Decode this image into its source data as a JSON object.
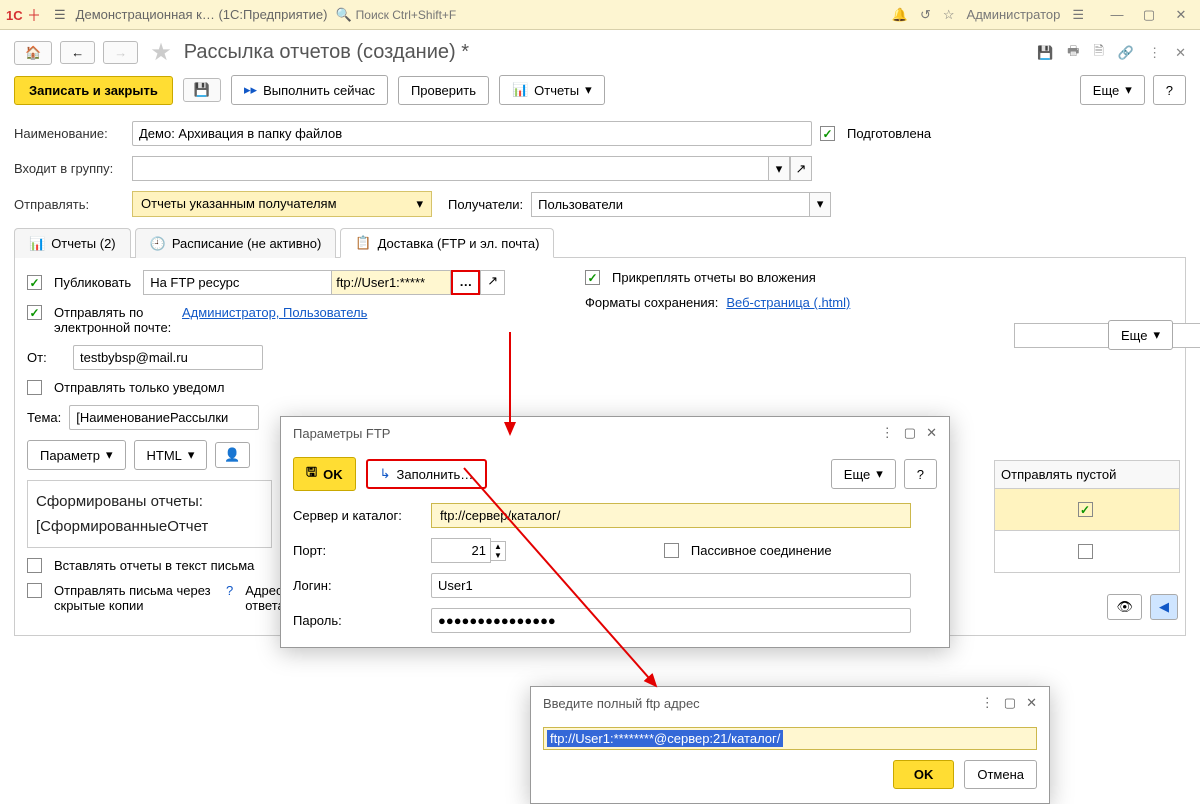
{
  "titlebar": {
    "app_name": "Демонстрационная к…",
    "platform": "(1С:Предприятие)",
    "search_placeholder": "Поиск Ctrl+Shift+F",
    "user": "Администратор"
  },
  "page": {
    "title": "Рассылка отчетов (создание) *"
  },
  "cmds": {
    "save_close": "Записать и закрыть",
    "run_now": "Выполнить сейчас",
    "check": "Проверить",
    "reports": "Отчеты",
    "more": "Еще",
    "help": "?"
  },
  "form": {
    "name_label": "Наименование:",
    "name_value": "Демо: Архивация в папку файлов",
    "prepared_label": "Подготовлена",
    "group_label": "Входит в группу:",
    "send_label": "Отправлять:",
    "send_value": "Отчеты указанным получателям",
    "recipients_label": "Получатели:",
    "recipients_value": "Пользователи"
  },
  "tabs": {
    "reports": "Отчеты (2)",
    "schedule": "Расписание (не активно)",
    "delivery": "Доставка (FTP и эл. почта)"
  },
  "delivery": {
    "publish_label": "Публиковать",
    "publish_target": "На FTP ресурс",
    "ftp_short": "ftp://User1:*****",
    "attach_label": "Прикреплять отчеты во вложения",
    "formats_label": "Форматы сохранения:",
    "formats_value": "Веб-страница (.html)",
    "email_label": "Отправлять по электронной почте:",
    "email_recipients": "Администратор, Пользователь",
    "from_label": "От:",
    "from_value": "testbybsp@mail.ru",
    "notify_only_label": "Отправлять только уведомл",
    "subject_label": "Тема:",
    "subject_value": "[НаименованиеРассылки",
    "param_btn": "Параметр",
    "html_btn": "HTML",
    "body_line1": "Сформированы отчеты:",
    "body_line2": "[СформированныеОтчет",
    "insert_reports_label": "Вставлять отчеты в текст письма",
    "bcc_label": "Отправлять письма через скрытые копии",
    "reply_label": "Адрес ответа:"
  },
  "table": {
    "col_send_empty": "Отправлять пустой"
  },
  "ftp_dialog": {
    "title": "Параметры FTP",
    "ok": "OK",
    "fill": "Заполнить…",
    "more": "Еще",
    "help": "?",
    "server_label": "Сервер и каталог:",
    "server_value": "ftp://сервер/каталог/",
    "port_label": "Порт:",
    "port_value": "21",
    "passive_label": "Пассивное соединение",
    "login_label": "Логин:",
    "login_value": "User1",
    "password_label": "Пароль:",
    "password_value": "●●●●●●●●●●●●●●●"
  },
  "addr_dialog": {
    "title": "Введите полный ftp адрес",
    "value": "ftp://User1:********@сервер:21/каталог/",
    "ok": "OK",
    "cancel": "Отмена"
  }
}
